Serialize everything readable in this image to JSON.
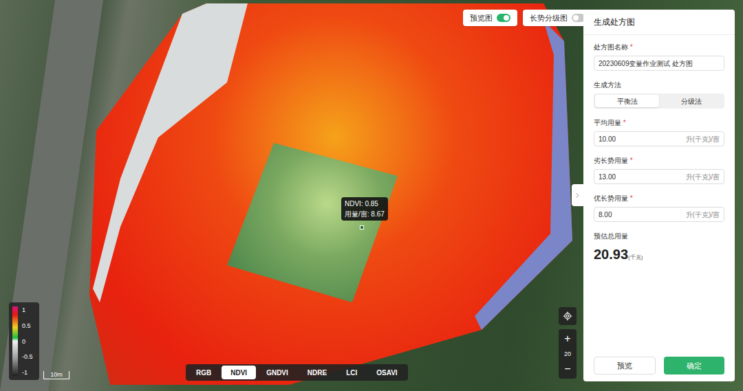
{
  "toggles": [
    {
      "label": "预览图",
      "on": true
    },
    {
      "label": "长势分级图",
      "on": false
    }
  ],
  "legend": {
    "ticks": [
      "1",
      "0.5",
      "0",
      "-0.5",
      "-1"
    ],
    "scale": "10m"
  },
  "index_tabs": [
    {
      "label": "RGB",
      "selected": false
    },
    {
      "label": "NDVI",
      "selected": true
    },
    {
      "label": "GNDVI",
      "selected": false
    },
    {
      "label": "NDRE",
      "selected": false
    },
    {
      "label": "LCI",
      "selected": false
    },
    {
      "label": "OSAVI",
      "selected": false
    }
  ],
  "zoom": {
    "plus": "+",
    "level": "20",
    "minus": "−"
  },
  "tooltip": {
    "lines": [
      "NDVI: 0.85",
      "用量/亩: 8.67"
    ]
  },
  "panel": {
    "title": "生成处方图",
    "name_field": {
      "label": "处方图名称",
      "mark": "*",
      "value": "20230609变量作业测试 处方图"
    },
    "method": {
      "label": "生成方法",
      "options": [
        {
          "label": "平衡法",
          "selected": true
        },
        {
          "label": "分级法",
          "selected": false
        }
      ]
    },
    "dose_fields": [
      {
        "label": "平均用量",
        "mark": "*",
        "value": "10.00",
        "unit": "升(千克)/亩"
      },
      {
        "label": "劣长势用量",
        "mark": "*",
        "value": "13.00",
        "unit": "升(千克)/亩"
      },
      {
        "label": "优长势用量",
        "mark": "*",
        "value": "8.00",
        "unit": "升(千克)/亩"
      }
    ],
    "total": {
      "label": "预估总用量",
      "value": "20.93",
      "unit": "(千克)"
    },
    "buttons": [
      {
        "label": "预览",
        "kind": "secondary"
      },
      {
        "label": "确定",
        "kind": "primary"
      }
    ]
  }
}
